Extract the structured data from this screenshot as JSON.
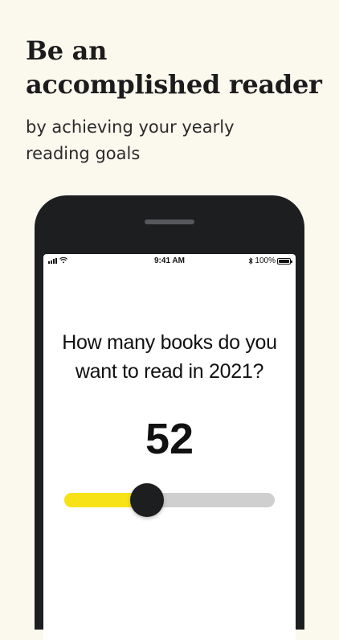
{
  "marketing": {
    "headline_line1": "Be an",
    "headline_line2": "accomplished reader",
    "subhead_line1": "by achieving your yearly",
    "subhead_line2": "reading goals"
  },
  "status_bar": {
    "time": "9:41 AM",
    "battery": "100%",
    "icons": [
      "signal-icon",
      "wifi-icon",
      "bluetooth-icon",
      "battery-icon"
    ]
  },
  "goal": {
    "question_line1": "How many books do you",
    "question_line2": "want to read in 2021?",
    "count": "52",
    "slider_fraction": 0.395
  },
  "colors": {
    "background": "#fbf8ee",
    "phone": "#1d1e20",
    "accent_yellow": "#f7e218",
    "track_gray": "#cfcfcf"
  }
}
